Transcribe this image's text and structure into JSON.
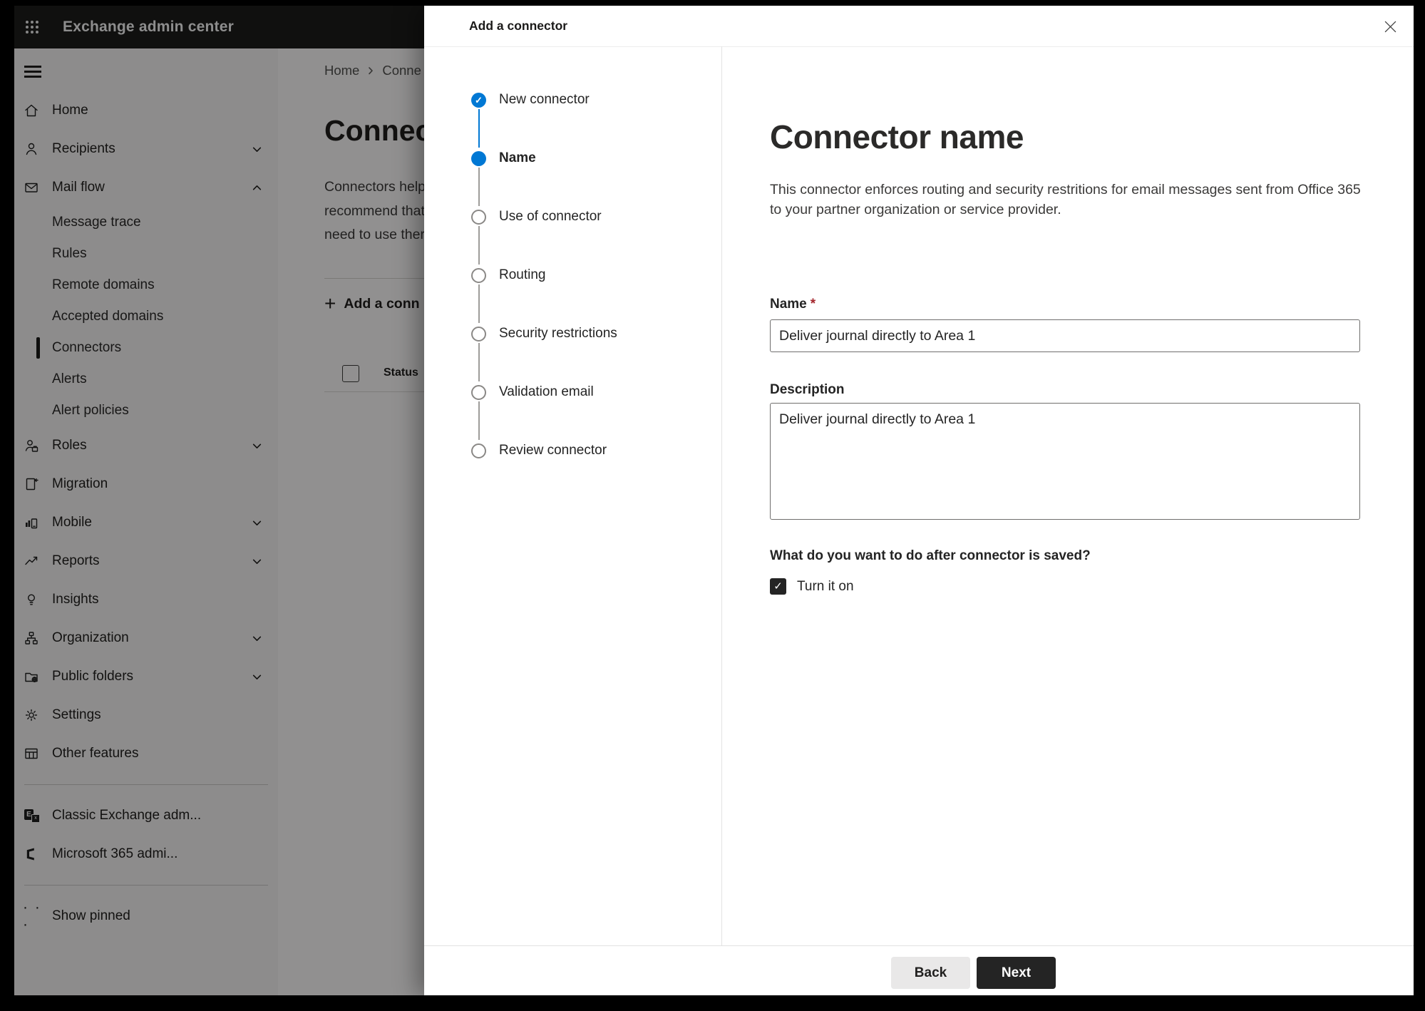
{
  "topbar": {
    "title": "Exchange admin center"
  },
  "icons": {
    "check": "✓",
    "close_hint": "✕",
    "plus": "+",
    "ellipsis": "· · ·",
    "exchange_letter": "E",
    "exchange_x": "x"
  },
  "sidebar": {
    "items_top": [
      {
        "label": "Home",
        "icon": "home-icon"
      },
      {
        "label": "Recipients",
        "icon": "person-icon",
        "chevron": "down"
      },
      {
        "label": "Mail flow",
        "icon": "mail-icon",
        "chevron": "up",
        "expanded": true
      }
    ],
    "mail_flow_children": [
      {
        "label": "Message trace"
      },
      {
        "label": "Rules"
      },
      {
        "label": "Remote domains"
      },
      {
        "label": "Accepted domains"
      },
      {
        "label": "Connectors",
        "selected": true
      },
      {
        "label": "Alerts"
      },
      {
        "label": "Alert policies"
      }
    ],
    "items_bottom": [
      {
        "label": "Roles",
        "icon": "roles-icon",
        "chevron": "down"
      },
      {
        "label": "Migration",
        "icon": "migration-icon"
      },
      {
        "label": "Mobile",
        "icon": "mobile-icon",
        "chevron": "down"
      },
      {
        "label": "Reports",
        "icon": "reports-icon",
        "chevron": "down"
      },
      {
        "label": "Insights",
        "icon": "insights-icon"
      },
      {
        "label": "Organization",
        "icon": "organization-icon",
        "chevron": "down"
      },
      {
        "label": "Public folders",
        "icon": "public-folders-icon",
        "chevron": "down"
      },
      {
        "label": "Settings",
        "icon": "settings-icon"
      },
      {
        "label": "Other features",
        "icon": "other-features-icon"
      }
    ],
    "external_links": [
      {
        "label": "Classic Exchange adm...",
        "icon": "classic-exchange-icon"
      },
      {
        "label": "Microsoft 365 admi...",
        "icon": "microsoft-365-icon"
      }
    ],
    "show_pinned": {
      "label": "Show pinned",
      "icon": "ellipsis-icon"
    }
  },
  "page": {
    "breadcrumb": {
      "home": "Home",
      "current": "Conne"
    },
    "title": "Connec",
    "intro_lines": [
      "Connectors help",
      "recommend that",
      "need to use ther"
    ],
    "add_connector_button": "Add a conn",
    "table": {
      "status_column": "Status"
    }
  },
  "wizard": {
    "title": "Add a connector",
    "steps": [
      {
        "label": "New connector",
        "state": "complete"
      },
      {
        "label": "Name",
        "state": "current"
      },
      {
        "label": "Use of connector",
        "state": "upcoming"
      },
      {
        "label": "Routing",
        "state": "upcoming"
      },
      {
        "label": "Security restrictions",
        "state": "upcoming"
      },
      {
        "label": "Validation email",
        "state": "upcoming"
      },
      {
        "label": "Review connector",
        "state": "upcoming"
      }
    ],
    "panel": {
      "heading": "Connector name",
      "description_lines": [
        "This connector enforces routing and security restritions for email messages sent from Office 365",
        "to your partner organization or service provider."
      ],
      "name_field": {
        "label": "Name",
        "required_marker": "*",
        "value": "Deliver journal directly to Area 1"
      },
      "description_field": {
        "label": "Description",
        "value": "Deliver journal directly to Area 1"
      },
      "after_save_question": "What do you want to do after connector is saved?",
      "turn_on_checkbox": {
        "label": "Turn it on",
        "checked": true
      }
    },
    "footer": {
      "back_button": "Back",
      "next_button": "Next"
    }
  },
  "colors": {
    "accent_blue": "#0078d4",
    "required_red": "#a4262c",
    "primary_button": "#242424",
    "topbar_bg": "#1d1c1b",
    "sidebar_bg": "#f3f2f1"
  }
}
